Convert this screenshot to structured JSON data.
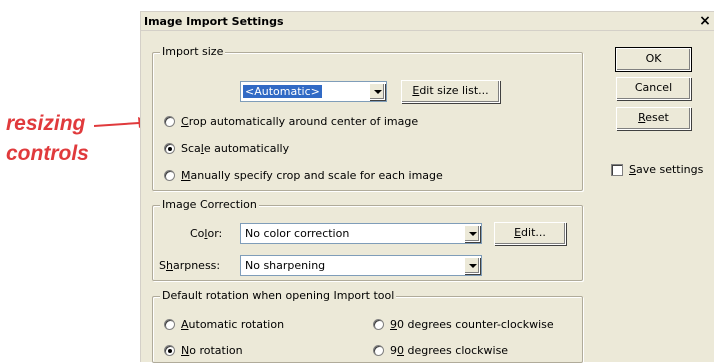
{
  "callout": {
    "line1": "resizing",
    "line2": "controls",
    "color": "#e03a3c"
  },
  "dialog": {
    "title": "Image Import Settings",
    "close_label": "×"
  },
  "import_size": {
    "legend": "Import size",
    "size_select_value": "<Automatic>",
    "edit_size_list": {
      "pre": "",
      "key": "E",
      "post": "dit size list..."
    },
    "options": [
      {
        "pre": "",
        "key": "C",
        "post": "rop automatically around center of image",
        "selected": false
      },
      {
        "pre": "Sca",
        "key": "l",
        "post": "e automatically",
        "selected": true
      },
      {
        "pre": "",
        "key": "M",
        "post": "anually specify crop and scale for each image",
        "selected": false
      }
    ]
  },
  "image_correction": {
    "legend": "Image Correction",
    "color_label": {
      "pre": "Co",
      "key": "l",
      "post": "or:"
    },
    "color_value": "No color correction",
    "edit_button": {
      "pre": "",
      "key": "E",
      "post": "dit..."
    },
    "sharpness_label": {
      "pre": "S",
      "key": "h",
      "post": "arpness:"
    },
    "sharpness_value": "No sharpening"
  },
  "rotation": {
    "legend": "Default rotation when opening Import tool",
    "options": [
      {
        "pre": "",
        "key": "A",
        "post": "utomatic rotation",
        "selected": false
      },
      {
        "pre": "",
        "key": "9",
        "post": "0 degrees counter-clockwise",
        "selected": false
      },
      {
        "pre": "",
        "key": "N",
        "post": "o rotation",
        "selected": true
      },
      {
        "pre": "9",
        "key": "0",
        "post": " degrees clockwise",
        "selected": false
      }
    ]
  },
  "buttons": {
    "ok": "OK",
    "cancel": "Cancel",
    "reset": {
      "pre": "",
      "key": "R",
      "post": "eset"
    }
  },
  "save_settings": {
    "pre": "",
    "key": "S",
    "post": "ave settings",
    "checked": false
  }
}
